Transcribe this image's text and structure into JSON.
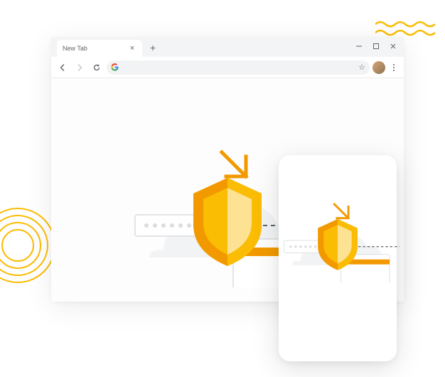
{
  "tab": {
    "title": "New Tab"
  },
  "omnibox": {
    "value": ""
  },
  "colors": {
    "orange_dark": "#F29900",
    "orange": "#FBBC04",
    "orange_light": "#FDE293",
    "grey_light": "#F1F3F4",
    "grey": "#DADCE0",
    "stroke_dark": "#5F6368"
  }
}
